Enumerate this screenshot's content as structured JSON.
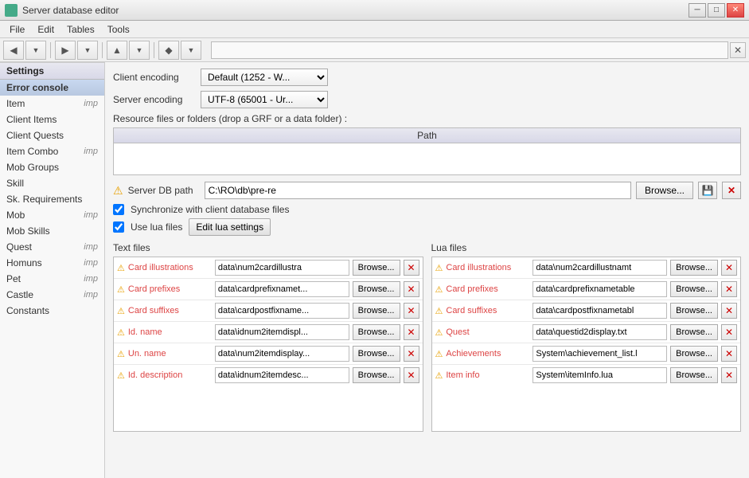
{
  "window": {
    "title": "Server database editor",
    "icon": "db-icon"
  },
  "menu": {
    "items": [
      "File",
      "Edit",
      "Tables",
      "Tools"
    ]
  },
  "toolbar": {
    "undo_label": "◀",
    "undo_arrow": "◀",
    "redo_label": "▶",
    "redo_arrow": "▶",
    "search_placeholder": "",
    "close_label": "✕"
  },
  "sidebar": {
    "section": "Settings",
    "items": [
      {
        "label": "Error console",
        "imp": ""
      },
      {
        "label": "Item",
        "imp": "imp"
      },
      {
        "label": "Client Items",
        "imp": ""
      },
      {
        "label": "Client Quests",
        "imp": ""
      },
      {
        "label": "Item Combo",
        "imp": "imp"
      },
      {
        "label": "Mob Groups",
        "imp": ""
      },
      {
        "label": "Skill",
        "imp": ""
      },
      {
        "label": "Sk. Requirements",
        "imp": ""
      },
      {
        "label": "Mob",
        "imp": "imp"
      },
      {
        "label": "Mob Skills",
        "imp": ""
      },
      {
        "label": "Quest",
        "imp": "imp"
      },
      {
        "label": "Homuns",
        "imp": "imp"
      },
      {
        "label": "Pet",
        "imp": "imp"
      },
      {
        "label": "Castle",
        "imp": "imp"
      },
      {
        "label": "Constants",
        "imp": ""
      }
    ]
  },
  "content": {
    "active_tab": "Settings",
    "client_encoding_label": "Client encoding",
    "client_encoding_value": "Default (1252 - W...",
    "server_encoding_label": "Server encoding",
    "server_encoding_value": "UTF-8 (65001 - Ur...",
    "resource_label": "Resource files or folders (drop a GRF or a data folder) :",
    "resource_table_header": "Path",
    "server_db_label": "Server DB path",
    "server_db_warning": "⚠",
    "server_db_path": "C:\\RO\\db\\pre-re",
    "browse_label": "Browse...",
    "sync_label": "Synchronize with client database files",
    "use_lua_label": "Use lua files",
    "edit_lua_label": "Edit lua settings",
    "text_files_title": "Text files",
    "lua_files_title": "Lua files",
    "text_files": [
      {
        "name": "Card illustrations",
        "path": "data\\num2cardillustra",
        "warning": true
      },
      {
        "name": "Card prefixes",
        "path": "data\\cardprefixnamet...",
        "warning": true
      },
      {
        "name": "Card suffixes",
        "path": "data\\cardpostfixname...",
        "warning": true
      },
      {
        "name": "Id. name",
        "path": "data\\idnum2itemdispl...",
        "warning": true
      },
      {
        "name": "Un. name",
        "path": "data\\num2itemdisplay...",
        "warning": true
      },
      {
        "name": "Id. description",
        "path": "data\\idnum2itemdesc...",
        "warning": true
      }
    ],
    "lua_files": [
      {
        "name": "Card illustrations",
        "path": "data\\num2cardillustnamt",
        "warning": true
      },
      {
        "name": "Card prefixes",
        "path": "data\\cardprefixnametable",
        "warning": true
      },
      {
        "name": "Card suffixes",
        "path": "data\\cardpostfixnametabl",
        "warning": true
      },
      {
        "name": "Quest",
        "path": "data\\questid2display.txt",
        "warning": true
      },
      {
        "name": "Achievements",
        "path": "System\\achievement_list.l",
        "warning": true
      },
      {
        "name": "Item info",
        "path": "System\\itemInfo.lua",
        "warning": true
      }
    ]
  }
}
